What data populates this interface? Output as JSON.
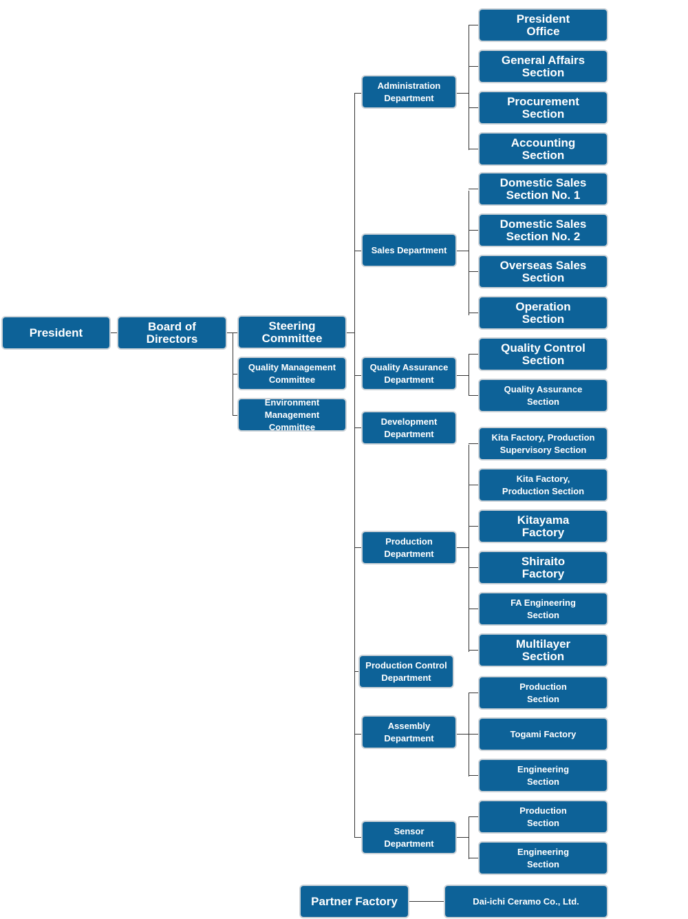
{
  "colors": {
    "box_fill": "#0d6298",
    "box_border": "#cdd3d8",
    "text": "#ffffff",
    "line": "#333333"
  },
  "top": {
    "president": "President",
    "board": "Board of\nDirectors"
  },
  "committees": [
    "Steering\nCommittee",
    "Quality Management\nCommittee",
    "Environment Management\nCommittee"
  ],
  "departments": [
    "Administration\nDepartment",
    "Sales Department",
    "Quality Assurance\nDepartment",
    "Development\nDepartment",
    "Production\nDepartment",
    "Production Control\nDepartment",
    "Assembly\nDepartment",
    "Sensor\nDepartment"
  ],
  "sections": [
    "President\nOffice",
    "General Affairs\nSection",
    "Procurement\nSection",
    "Accounting\nSection",
    "Domestic Sales\nSection No. 1",
    "Domestic Sales\nSection No. 2",
    "Overseas Sales\nSection",
    "Operation\nSection",
    "Quality Control\nSection",
    "Quality Assurance\nSection",
    "Kita Factory, Production\nSupervisory Section",
    "Kita Factory,\nProduction Section",
    "Kitayama\nFactory",
    "Shiraito\nFactory",
    "FA Engineering\nSection",
    "Multilayer\nSection",
    "Production\nSection",
    "Togami Factory",
    "Engineering\nSection",
    "Production\nSection",
    "Engineering\nSection"
  ],
  "partner": {
    "label": "Partner Factory",
    "company": "Dai-ichi Ceramo Co., Ltd."
  }
}
